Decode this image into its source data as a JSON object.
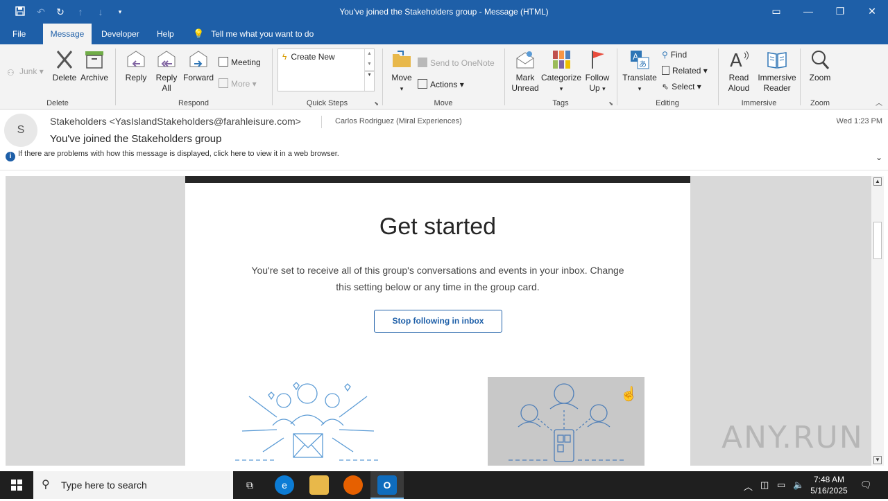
{
  "window": {
    "title": "You've joined the Stakeholders group  -  Message (HTML)"
  },
  "menu": {
    "file": "File",
    "message": "Message",
    "developer": "Developer",
    "help": "Help",
    "tell_me": "Tell me what you want to do"
  },
  "ribbon": {
    "junk": "Junk",
    "delete": "Delete",
    "archive": "Archive",
    "delete_group": "Delete",
    "reply": "Reply",
    "reply_all_1": "Reply",
    "reply_all_2": "All",
    "forward": "Forward",
    "meeting": "Meeting",
    "more": "More",
    "respond_group": "Respond",
    "create_new": "Create New",
    "quicksteps_group": "Quick Steps",
    "move": "Move",
    "send_onenote": "Send to OneNote",
    "actions": "Actions",
    "move_group": "Move",
    "mark_unread_1": "Mark",
    "mark_unread_2": "Unread",
    "categorize": "Categorize",
    "follow_up_1": "Follow",
    "follow_up_2": "Up",
    "tags_group": "Tags",
    "translate": "Translate",
    "find": "Find",
    "related": "Related",
    "select": "Select",
    "editing_group": "Editing",
    "read_aloud_1": "Read",
    "read_aloud_2": "Aloud",
    "immersive_1": "Immersive",
    "immersive_2": "Reader",
    "immersive_group": "Immersive",
    "zoom": "Zoom",
    "zoom_group": "Zoom"
  },
  "message": {
    "avatar_initial": "S",
    "from": "Stakeholders <YasIslandStakeholders@farahleisure.com>",
    "to": "Carlos Rodriguez (Miral Experiences)",
    "date": "Wed 1:23 PM",
    "subject": "You've joined the Stakeholders group",
    "info": "If there are problems with how this message is displayed, click here to view it in a web browser."
  },
  "email_body": {
    "heading": "Get started",
    "description": "You're set to receive all of this group's conversations and events in your inbox. Change this setting below or any time in the group card.",
    "stop_button": "Stop following in inbox"
  },
  "watermark": "ANY.RUN",
  "taskbar": {
    "search_placeholder": "Type here to search",
    "time": "7:48 AM",
    "date": "5/16/2025"
  },
  "colors": {
    "accent": "#1e5fa8",
    "illustration": "#5b9bd5"
  }
}
